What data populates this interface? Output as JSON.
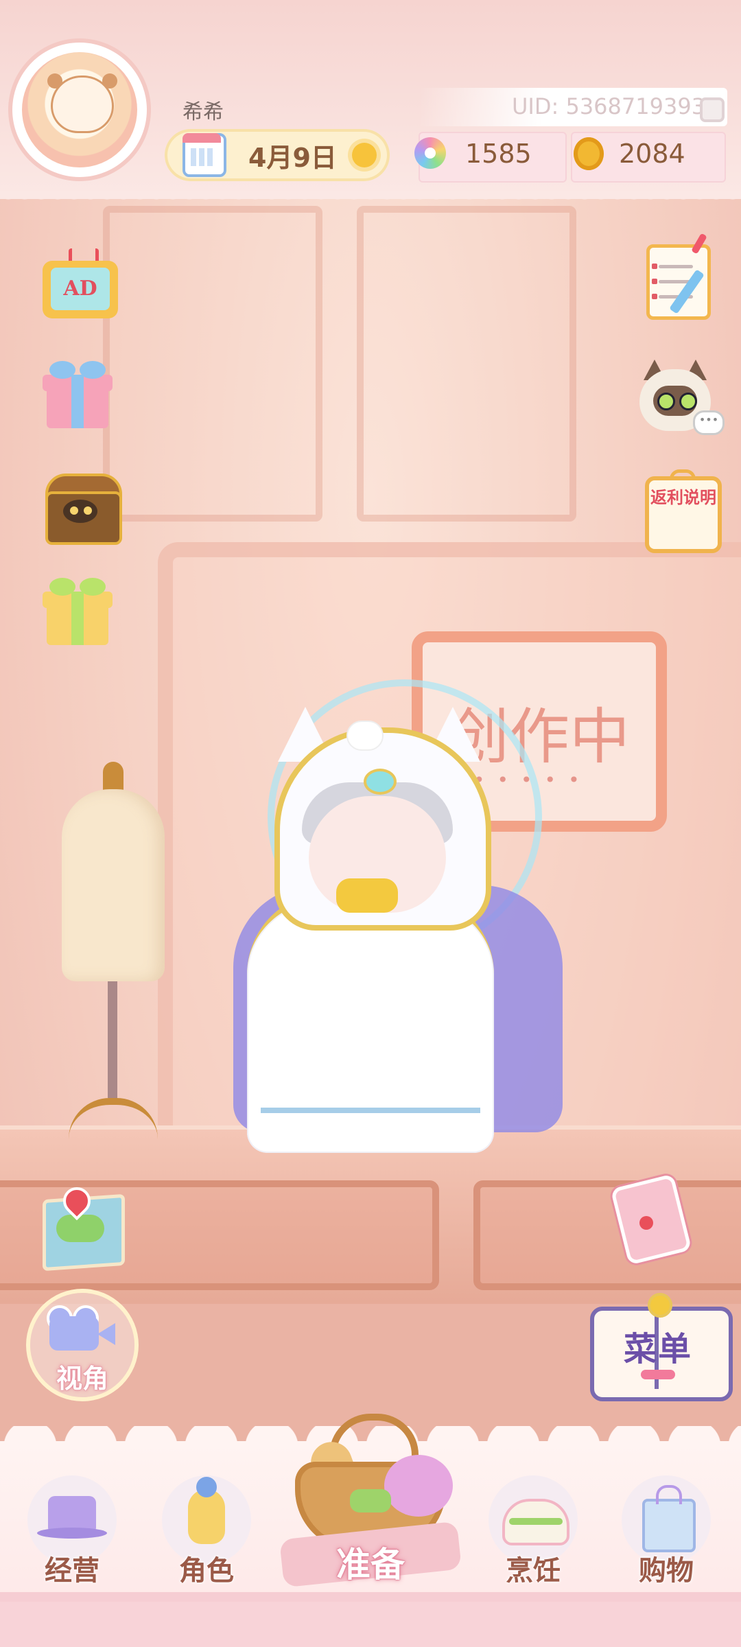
{
  "header": {
    "username": "希希",
    "date": "4月9日",
    "uid": "UID: 5368719393",
    "gems": "1585",
    "coins": "2084"
  },
  "left_icons": {
    "ad_label": "AD"
  },
  "right_icons": {
    "rebate_label": "返利说明"
  },
  "scene": {
    "sign_text": "创作中"
  },
  "controls": {
    "camera_label": "视角",
    "menu_label": "菜单"
  },
  "bottom_nav": {
    "items": [
      {
        "label": "经营"
      },
      {
        "label": "角色"
      },
      {
        "label": "准备"
      },
      {
        "label": "烹饪"
      },
      {
        "label": "购物"
      }
    ]
  },
  "colors": {
    "accent_pink": "#f6cdd3",
    "text_brown": "#8a5b3a",
    "label_brown": "#9b5a48"
  }
}
